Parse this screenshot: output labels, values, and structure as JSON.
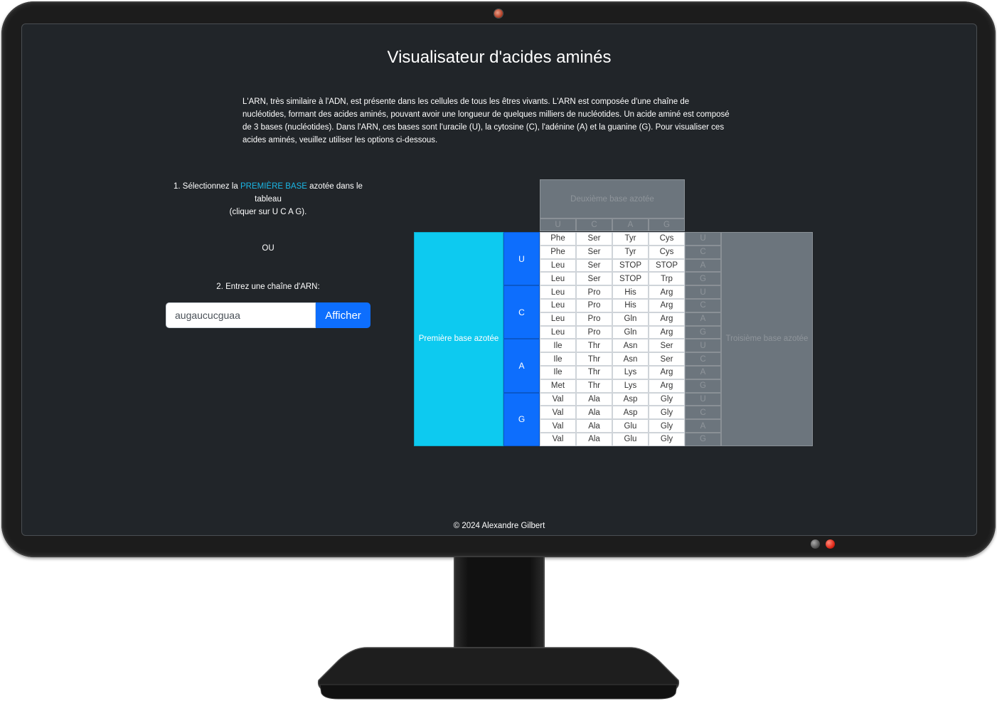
{
  "page": {
    "title": "Visualisateur d'acides aminés",
    "intro": "L'ARN, très similaire à l'ADN, est présente dans les cellules de tous les êtres vivants. L'ARN est composée d'une chaîne de nucléotides, formant des acides aminés, pouvant avoir une longueur de quelques milliers de nucléotides. Un acide aminé est composé de 3 bases (nucléotides). Dans l'ARN, ces bases sont l'uracile (U), la cytosine (C), l'adénine (A) et la guanine (G). Pour visualiser ces acides aminés, veuillez utiliser les options ci-dessous."
  },
  "instructions": {
    "step1_prefix": "1. Sélectionnez la ",
    "step1_highlight": "PREMIÈRE BASE",
    "step1_suffix": " azotée dans le tableau",
    "step1_hint": "(cliquer sur U C A G).",
    "or": "OU",
    "step2": "2. Entrez une chaîne d'ARN:"
  },
  "rna_form": {
    "value": "augaucucguaa",
    "button_label": "Afficher"
  },
  "codon_table": {
    "second_base_label": "Deuxième base azotée",
    "first_base_label": "Première base azotée",
    "third_base_label": "Troisième base azotée",
    "bases": [
      "U",
      "C",
      "A",
      "G"
    ],
    "rows": [
      [
        "Phe",
        "Ser",
        "Tyr",
        "Cys"
      ],
      [
        "Phe",
        "Ser",
        "Tyr",
        "Cys"
      ],
      [
        "Leu",
        "Ser",
        "STOP",
        "STOP"
      ],
      [
        "Leu",
        "Ser",
        "STOP",
        "Trp"
      ],
      [
        "Leu",
        "Pro",
        "His",
        "Arg"
      ],
      [
        "Leu",
        "Pro",
        "His",
        "Arg"
      ],
      [
        "Leu",
        "Pro",
        "Gln",
        "Arg"
      ],
      [
        "Leu",
        "Pro",
        "Gln",
        "Arg"
      ],
      [
        "Ile",
        "Thr",
        "Asn",
        "Ser"
      ],
      [
        "Ile",
        "Thr",
        "Asn",
        "Ser"
      ],
      [
        "Ile",
        "Thr",
        "Lys",
        "Arg"
      ],
      [
        "Met",
        "Thr",
        "Lys",
        "Arg"
      ],
      [
        "Val",
        "Ala",
        "Asp",
        "Gly"
      ],
      [
        "Val",
        "Ala",
        "Asp",
        "Gly"
      ],
      [
        "Val",
        "Ala",
        "Glu",
        "Gly"
      ],
      [
        "Val",
        "Ala",
        "Glu",
        "Gly"
      ]
    ]
  },
  "footer": {
    "text": "© 2024 Alexandre Gilbert"
  },
  "colors": {
    "screen_bg": "#212529",
    "first_base_label": "#0dcaf0",
    "first_base_cells": "#0d6efd",
    "grey_headers": "#6c757d",
    "highlight": "#1ab7e6"
  }
}
